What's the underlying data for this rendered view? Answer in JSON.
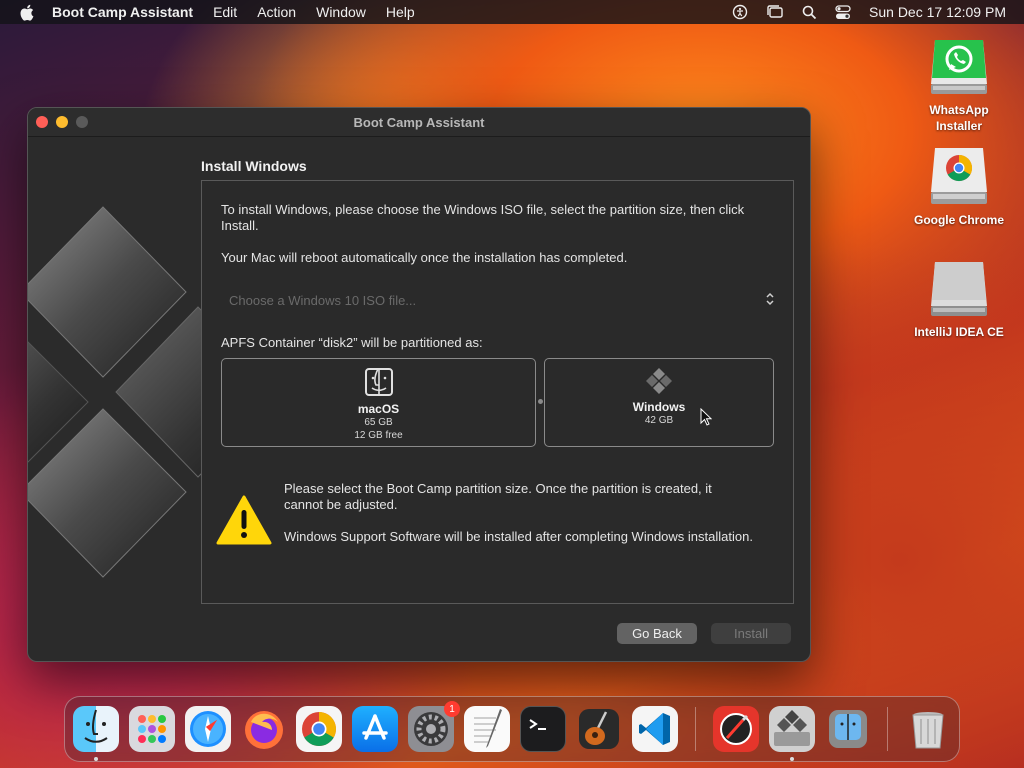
{
  "menubar": {
    "app_name": "Boot Camp Assistant",
    "menus": [
      "Edit",
      "Action",
      "Window",
      "Help"
    ],
    "datetime": "Sun Dec 17  12:09 PM"
  },
  "desktop_icons": [
    {
      "label_line1": "WhatsApp",
      "label_line2": "Installer"
    },
    {
      "label_line1": "Google Chrome",
      "label_line2": ""
    },
    {
      "label_line1": "IntelliJ IDEA CE",
      "label_line2": ""
    }
  ],
  "window": {
    "title": "Boot Camp Assistant",
    "section_title": "Install Windows",
    "intro": "To install Windows, please choose the Windows ISO file, select the partition size, then click Install.",
    "reboot_note": "Your Mac will reboot automatically once the installation has completed.",
    "iso_placeholder": "Choose a Windows 10 ISO file...",
    "container_label": "APFS Container “disk2” will be partitioned as:",
    "macos": {
      "name": "macOS",
      "size": "65 GB",
      "free": "12 GB free"
    },
    "windows": {
      "name": "Windows",
      "size": "42 GB"
    },
    "warning_1": "Please select the Boot Camp partition size. Once the partition is created, it cannot be adjusted.",
    "warning_2": "Windows Support Software will be installed after completing Windows installation.",
    "go_back": "Go Back",
    "install": "Install"
  },
  "dock": {
    "settings_badge": "1"
  },
  "colors": {
    "close": "#ff5f57",
    "minimize": "#febc2e",
    "warning": "#ffd60a"
  }
}
